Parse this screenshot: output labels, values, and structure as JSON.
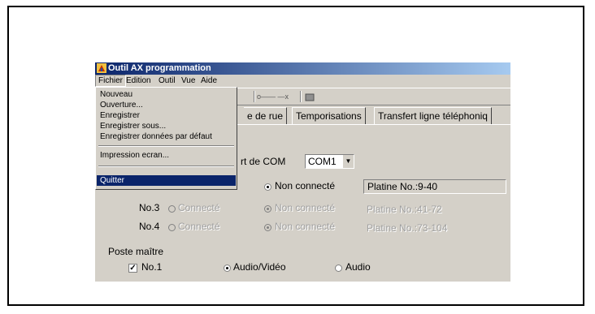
{
  "window": {
    "title": "Outil AX programmation"
  },
  "menubar": {
    "items": [
      "Fichier",
      "Edition",
      "Outil",
      "Vue",
      "Aide"
    ]
  },
  "file_menu": {
    "items": [
      "Nouveau",
      "Ouverture...",
      "Enregistrer",
      "Enregistrer sous...",
      "Enregistrer données par défaut",
      "Impression ecran...",
      "Quitter"
    ],
    "highlighted": "Quitter"
  },
  "toolbar": {
    "link_label": "o—— —x"
  },
  "tabs": [
    "e de rue",
    "Temporisations",
    "Transfert ligne téléphoniq"
  ],
  "com": {
    "label_fragment": "rt de COM",
    "value": "COM1"
  },
  "rows": [
    {
      "name": "",
      "opt1": "",
      "opt2": "Non connecté",
      "opt2_selected": true,
      "platine": "Platine No.:9-40",
      "enabled": true
    },
    {
      "name": "No.3",
      "opt1": "Connecté",
      "opt2": "Non connecté",
      "opt2_selected": true,
      "platine": "Platine No.:41-72",
      "enabled": false
    },
    {
      "name": "No.4",
      "opt1": "Connecté",
      "opt2": "Non connecté",
      "opt2_selected": true,
      "platine": "Platine No.:73-104",
      "enabled": false
    }
  ],
  "poste_maitre": {
    "label": "Poste maître",
    "check_label": "No.1",
    "checked": true,
    "audio_video": "Audio/Vidéo",
    "audio": "Audio",
    "selected": "Audio/Vidéo"
  },
  "colors": {
    "titlebar_start": "#0a246a",
    "titlebar_end": "#a6caf0",
    "face": "#d4d0c8",
    "highlight": "#0a246a"
  }
}
